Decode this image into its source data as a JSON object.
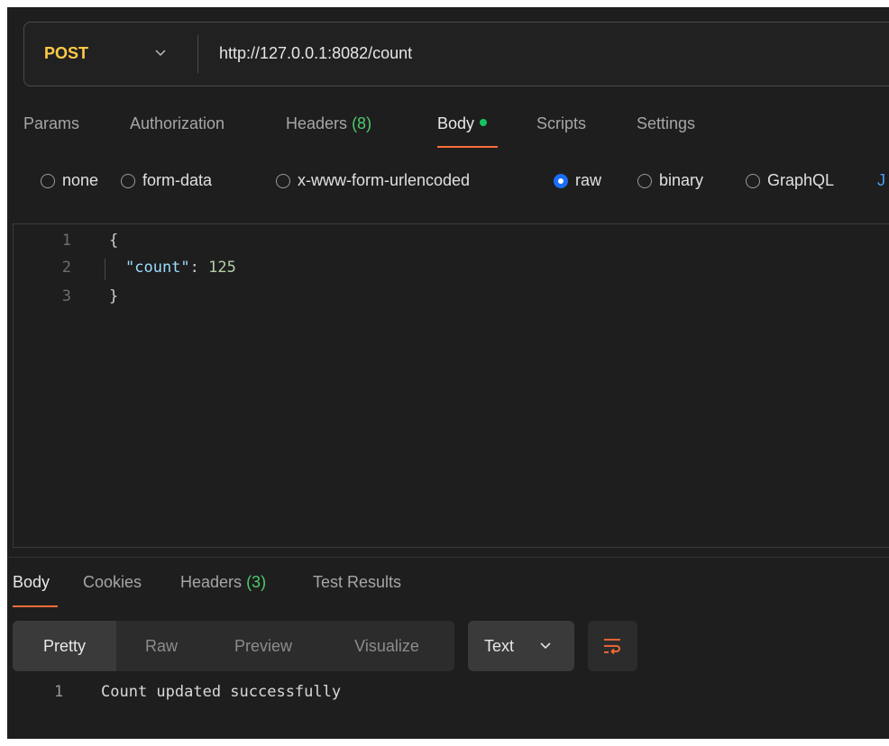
{
  "request": {
    "method": "POST",
    "url": "http://127.0.0.1:8082/count"
  },
  "request_tabs": {
    "params": "Params",
    "authorization": "Authorization",
    "headers": "Headers",
    "headers_count": "(8)",
    "body": "Body",
    "scripts": "Scripts",
    "settings": "Settings"
  },
  "body_types": {
    "none": "none",
    "form_data": "form-data",
    "urlencoded": "x-www-form-urlencoded",
    "raw": "raw",
    "binary": "binary",
    "graphql": "GraphQL",
    "json_cutoff": "J",
    "selected": "raw"
  },
  "editor": {
    "lines": [
      {
        "num": "1",
        "text": "{"
      },
      {
        "num": "2",
        "key": "\"count\"",
        "sep": ": ",
        "value": "125"
      },
      {
        "num": "3",
        "text": "}"
      }
    ]
  },
  "response_tabs": {
    "body": "Body",
    "cookies": "Cookies",
    "headers": "Headers",
    "headers_count": "(3)",
    "test_results": "Test Results"
  },
  "view_modes": {
    "pretty": "Pretty",
    "raw": "Raw",
    "preview": "Preview",
    "visualize": "Visualize",
    "format": "Text"
  },
  "response": {
    "line_num": "1",
    "text": "Count updated successfully"
  },
  "colors": {
    "method": "#ffc947",
    "accent": "#ff6c37",
    "radio_selected": "#1a6ef5",
    "count_green": "#4ec96e"
  }
}
